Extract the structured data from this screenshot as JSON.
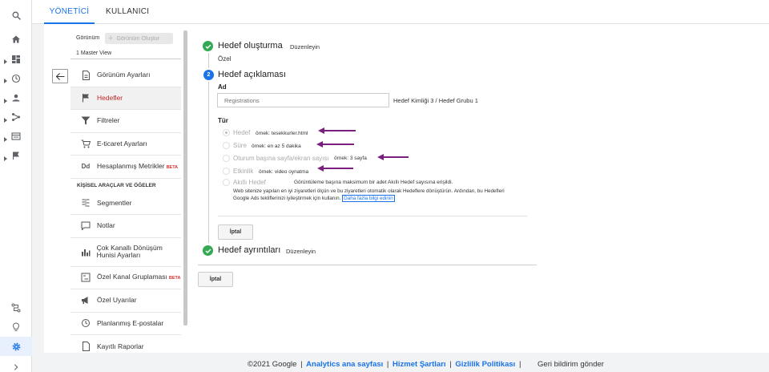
{
  "tabs": {
    "admin": "YÖNETİCİ",
    "user": "KULLANICI"
  },
  "view": {
    "label": "Görünüm",
    "create_button": "Görünüm Oluştur",
    "selected": "1 Master View"
  },
  "menu": {
    "items": [
      {
        "label": "Görünüm Ayarları",
        "icon": "document-icon"
      },
      {
        "label": "Hedefler",
        "icon": "flag-icon"
      },
      {
        "label": "Filtreler",
        "icon": "filter-icon"
      },
      {
        "label": "E-ticaret Ayarları",
        "icon": "cart-icon"
      },
      {
        "label": "Hesaplanmış Metrikler",
        "beta": "BETA",
        "icon": "dd-icon"
      }
    ],
    "section_title": "KİŞİSEL ARAÇLAR VE ÖĞELER",
    "personal_items": [
      {
        "label": "Segmentler",
        "icon": "segments-icon"
      },
      {
        "label": "Notlar",
        "icon": "comment-icon"
      },
      {
        "label": "Çok Kanallı Dönüşüm Hunisi Ayarları",
        "icon": "bar-chart-icon"
      },
      {
        "label": "Özel Kanal Gruplaması",
        "beta": "BETA",
        "icon": "channel-icon"
      },
      {
        "label": "Özel Uyarılar",
        "icon": "megaphone-icon"
      },
      {
        "label": "Planlanmış E-postalar",
        "icon": "clock-icon"
      },
      {
        "label": "Kayıtlı Raporlar",
        "icon": "report-icon"
      }
    ]
  },
  "goal_setup": {
    "title": "Hedef oluşturma",
    "edit": "Düzenleyin",
    "value": "Özel"
  },
  "goal_description": {
    "step": "2",
    "title": "Hedef açıklaması",
    "name_label": "Ad",
    "name_placeholder": "Registrations",
    "goal_id": "Hedef Kimliği 3 / Hedef Grubu 1",
    "type_label": "Tür",
    "types": [
      {
        "label": "Hedef",
        "example": "örnek: tesekkurler.html"
      },
      {
        "label": "Süre",
        "example": "örnek: en az 5 dakika"
      },
      {
        "label": "Oturum başına sayfa/ekran sayısı",
        "example": "örnek: 3 sayfa"
      },
      {
        "label": "Etkinlik",
        "example": "örnek: video oynatma"
      },
      {
        "label": "Akıllı Hedef",
        "example": "Görüntüleme başına maksimum bir adet Akıllı Hedef sayısına erişildi."
      }
    ],
    "smart_desc_line1": "Web sitenize yapılan en iyi ziyaretleri ölçün ve bu ziyaretleri otomatik olarak Hedeflere dönüştürün. Ardından, bu Hedefleri",
    "smart_desc_line2": "Google Ads tekliflerinizi iyileştirmek için kullanın.",
    "learn_more": "Daha fazla bilgi edinin",
    "cancel": "İptal"
  },
  "goal_details": {
    "title": "Hedef ayrıntıları",
    "edit": "Düzenleyin"
  },
  "bottom_cancel": "İptal",
  "footer": {
    "copyright": "©2021 Google",
    "links": [
      "Analytics ana sayfası",
      "Hizmet Şartları",
      "Gizlilik Politikası"
    ],
    "feedback": "Geri bildirim gönder"
  },
  "colors": {
    "accent": "#1a73e8",
    "success": "#34a853",
    "selected_text": "#c62828",
    "arrow": "#7b1f7e"
  }
}
